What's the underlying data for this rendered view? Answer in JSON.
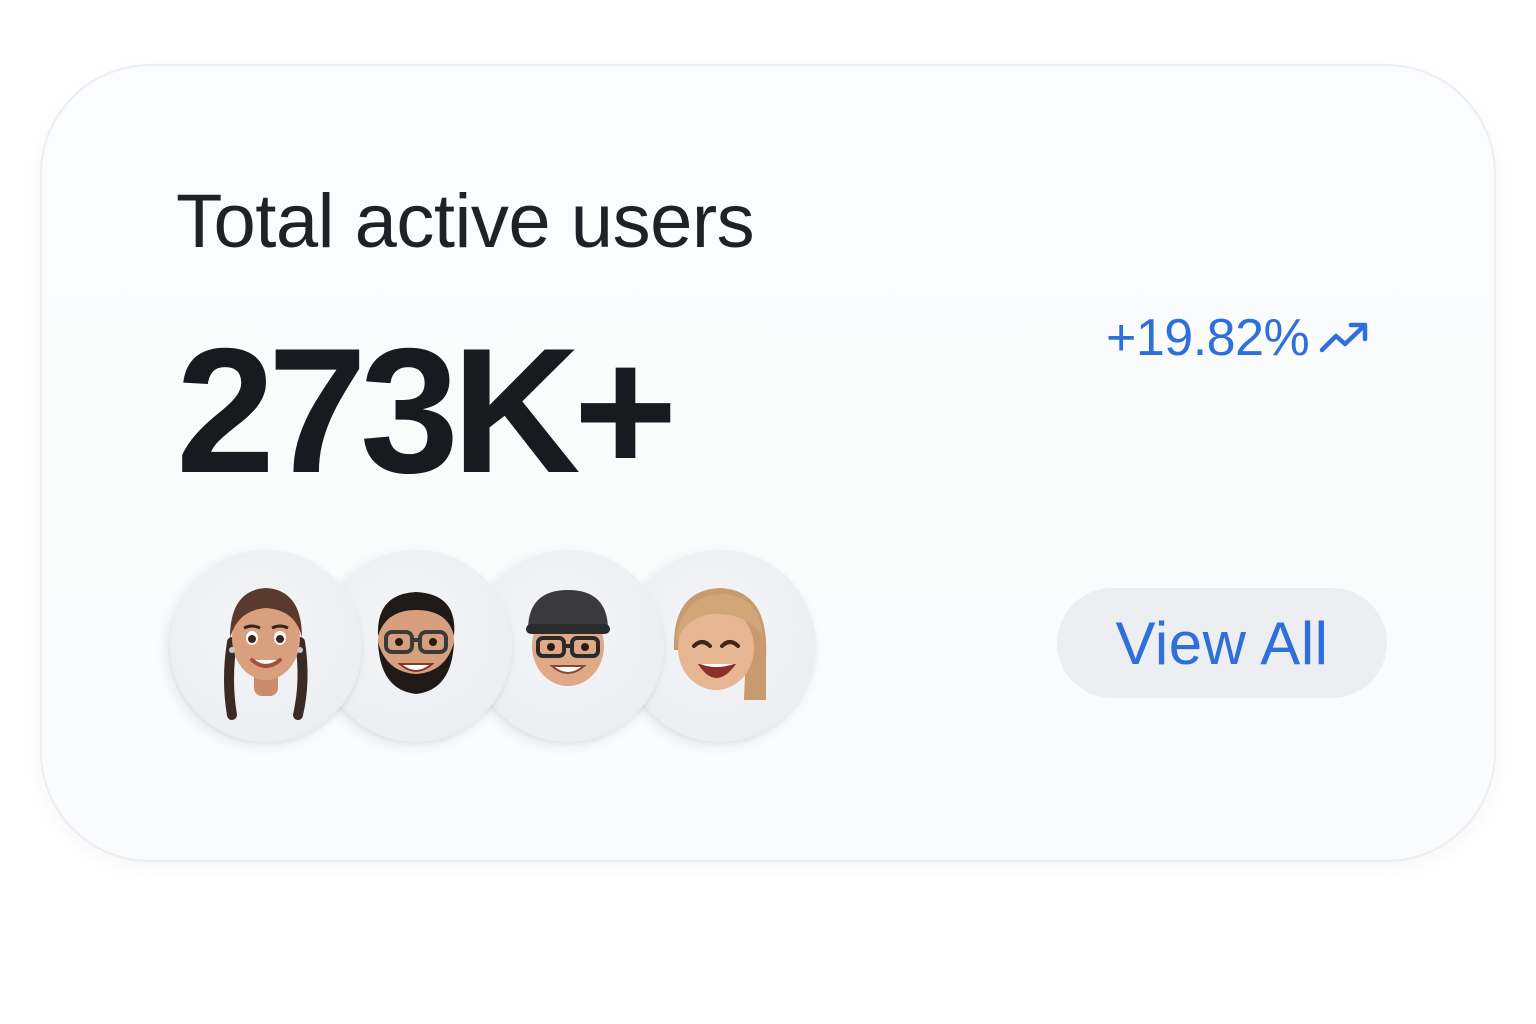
{
  "card": {
    "title": "Total active users",
    "metric": "273K+",
    "change": {
      "value": "+19.82%",
      "direction": "up",
      "icon": "trending-up-icon",
      "color": "#2f6fd9"
    },
    "avatars": [
      {
        "icon": "memoji-woman-braids"
      },
      {
        "icon": "memoji-man-beard-glasses"
      },
      {
        "icon": "memoji-man-cap-glasses"
      },
      {
        "icon": "memoji-woman-blonde"
      }
    ],
    "view_all_label": "View All"
  },
  "colors": {
    "accent": "#2f6fd9",
    "text_primary": "#171b1f",
    "button_bg": "#eceef1"
  }
}
